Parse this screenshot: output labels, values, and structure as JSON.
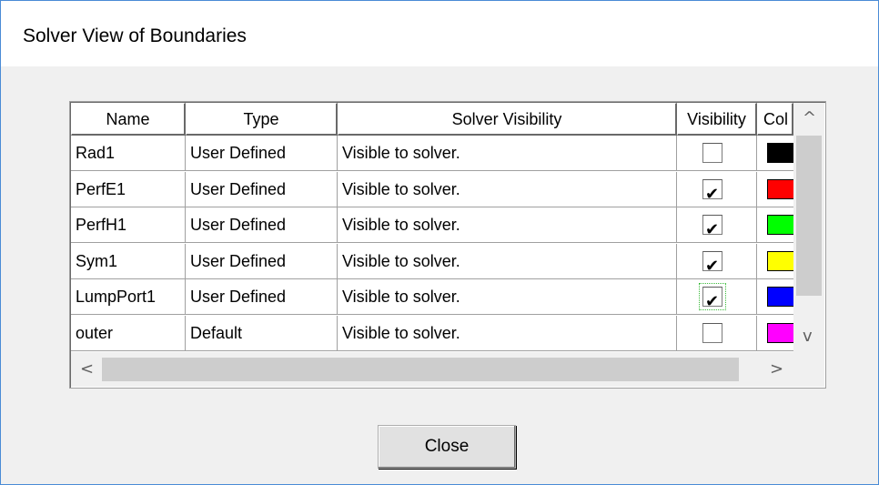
{
  "window": {
    "title": "Solver View of Boundaries"
  },
  "table": {
    "columns": [
      "Name",
      "Type",
      "Solver Visibility",
      "Visibility",
      "Col"
    ],
    "rows": [
      {
        "name": "Rad1",
        "type": "User Defined",
        "solver_visibility": "Visible to solver.",
        "visible": false,
        "color": "#000000"
      },
      {
        "name": "PerfE1",
        "type": "User Defined",
        "solver_visibility": "Visible to solver.",
        "visible": true,
        "color": "#ff0000"
      },
      {
        "name": "PerfH1",
        "type": "User Defined",
        "solver_visibility": "Visible to solver.",
        "visible": true,
        "color": "#00ff00"
      },
      {
        "name": "Sym1",
        "type": "User Defined",
        "solver_visibility": "Visible to solver.",
        "visible": true,
        "color": "#ffff00"
      },
      {
        "name": "LumpPort1",
        "type": "User Defined",
        "solver_visibility": "Visible to solver.",
        "visible": true,
        "color": "#0000ff",
        "focused": true
      },
      {
        "name": "outer",
        "type": "Default",
        "solver_visibility": "Visible to solver.",
        "visible": false,
        "color": "#ff00ff"
      }
    ]
  },
  "buttons": {
    "close": "Close"
  },
  "icons": {
    "up": "^",
    "down": "v",
    "left": "<",
    "right": ">"
  }
}
